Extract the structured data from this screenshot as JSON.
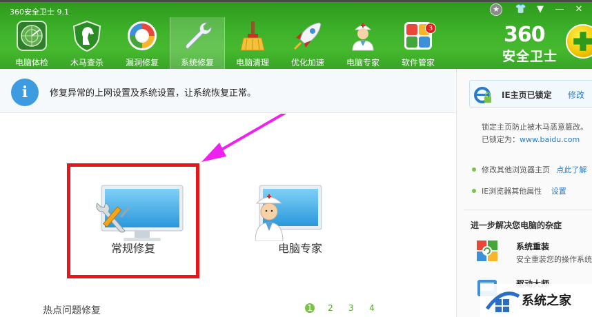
{
  "window": {
    "title": "360安全卫士 9.1",
    "controls": {
      "star": "★",
      "skin": "👕",
      "menu": "▼",
      "minimize": "—",
      "close": "✕"
    }
  },
  "nav": {
    "items": [
      {
        "label": "电脑体检",
        "icon": "radar-icon"
      },
      {
        "label": "木马查杀",
        "icon": "horse-shield-icon"
      },
      {
        "label": "漏洞修复",
        "icon": "patch-ring-icon"
      },
      {
        "label": "系统修复",
        "icon": "wrench-icon",
        "active": true
      },
      {
        "label": "电脑清理",
        "icon": "broom-icon"
      },
      {
        "label": "优化加速",
        "icon": "rocket-icon"
      },
      {
        "label": "电脑专家",
        "icon": "doctor-icon"
      },
      {
        "label": "软件管家",
        "icon": "app-grid-icon"
      }
    ],
    "badge": "3"
  },
  "brand": {
    "number": "360",
    "name": "安全卫士"
  },
  "banner": {
    "text": "修复异常的上网设置及系统设置，让系统恢复正常。"
  },
  "tiles": [
    {
      "label": "常规修复",
      "icon": "monitor-tools-icon"
    },
    {
      "label": "电脑专家",
      "icon": "monitor-doctor-icon"
    }
  ],
  "hot_fix": {
    "label": "热点问题修复",
    "pages": [
      "1",
      "2",
      "3",
      "4"
    ],
    "current": "1"
  },
  "right_panel": {
    "lock": {
      "label": "IE主页已锁定",
      "edit": "修改"
    },
    "lock_desc": "锁定主页防止被木马恶意篡改。",
    "locked_to_label": "已锁定为：",
    "locked_to_url": "www.baidu.com",
    "options": [
      {
        "text": "修改其他浏览器主页",
        "link": "点此了解"
      },
      {
        "text": "IE浏览器其他属性",
        "link": "设置"
      }
    ],
    "section_title": "进一步解决您电脑的杂症",
    "tools": [
      {
        "title": "系统重装",
        "desc": "安全重装您的操作系统"
      },
      {
        "title": "驱动大师",
        "desc": ""
      }
    ]
  },
  "watermark": {
    "text": "系统之家"
  },
  "colors": {
    "green_dark": "#2e9a1c",
    "green": "#46b92f",
    "highlight_red": "#e8161a",
    "arrow_magenta": "#ee22ee",
    "link_blue": "#2a7bc4"
  }
}
